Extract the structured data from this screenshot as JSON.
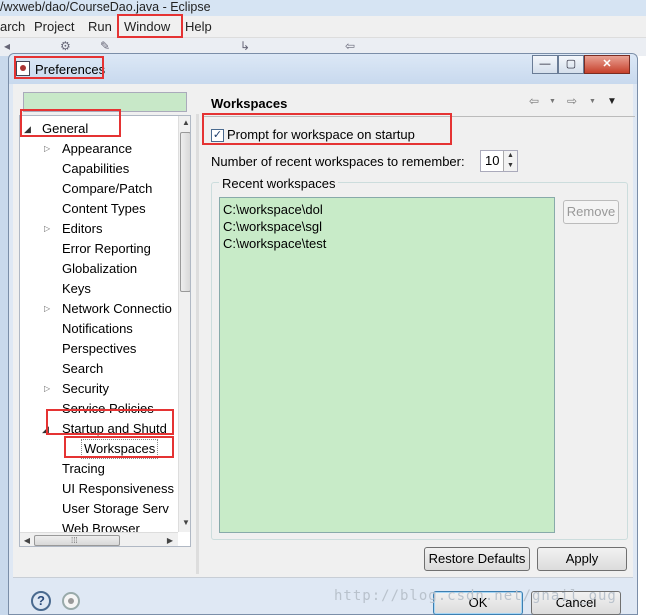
{
  "eclipse": {
    "title": "/wxweb/dao/CourseDao.java - Eclipse",
    "menus": [
      "arch",
      "Project",
      "Run",
      "Window",
      "Help"
    ]
  },
  "dialog": {
    "title": "Preferences",
    "window_buttons": {
      "minimize": "—",
      "maximize": "▢",
      "close": "✕"
    }
  },
  "tree": {
    "root": "General",
    "items": [
      {
        "label": "Appearance",
        "expandable": true
      },
      {
        "label": "Capabilities",
        "expandable": false
      },
      {
        "label": "Compare/Patch",
        "expandable": false
      },
      {
        "label": "Content Types",
        "expandable": false
      },
      {
        "label": "Editors",
        "expandable": true
      },
      {
        "label": "Error Reporting",
        "expandable": false
      },
      {
        "label": "Globalization",
        "expandable": false
      },
      {
        "label": "Keys",
        "expandable": false
      },
      {
        "label": "Network Connectio",
        "expandable": true
      },
      {
        "label": "Notifications",
        "expandable": false
      },
      {
        "label": "Perspectives",
        "expandable": false
      },
      {
        "label": "Search",
        "expandable": false
      },
      {
        "label": "Security",
        "expandable": true
      },
      {
        "label": "Service Policies",
        "expandable": false
      },
      {
        "label": "Startup and Shutd",
        "expandable": true,
        "expanded": true
      },
      {
        "label": "Workspaces",
        "expandable": false,
        "selected": true,
        "child": true
      },
      {
        "label": "Tracing",
        "expandable": false
      },
      {
        "label": "UI Responsiveness",
        "expandable": false
      },
      {
        "label": "User Storage Serv",
        "expandable": false
      },
      {
        "label": "Web Browser",
        "expandable": false
      }
    ]
  },
  "page": {
    "title": "Workspaces",
    "nav": {
      "back": "⇦",
      "forward": "⇨",
      "menu": "▼"
    },
    "prompt_label": "Prompt for workspace on startup",
    "prompt_checked": true,
    "recent_count_label": "Number of recent workspaces to remember:",
    "recent_count_value": "10",
    "group_label": "Recent workspaces",
    "workspaces": [
      "C:\\workspace\\dol",
      "C:\\workspace\\sgl",
      "C:\\workspace\\test"
    ],
    "remove_label": "Remove",
    "restore_defaults_label": "Restore Defaults",
    "apply_label": "Apply"
  },
  "footer": {
    "help_glyph": "?",
    "ok_label": "OK",
    "cancel_label": "Cancel"
  },
  "watermark": "http://blog.csdn.net/gnail_oug",
  "colors": {
    "highlight": "#e53333",
    "list_bg": "#c8ebc8",
    "dialog_bg": "#f0f0f0"
  }
}
